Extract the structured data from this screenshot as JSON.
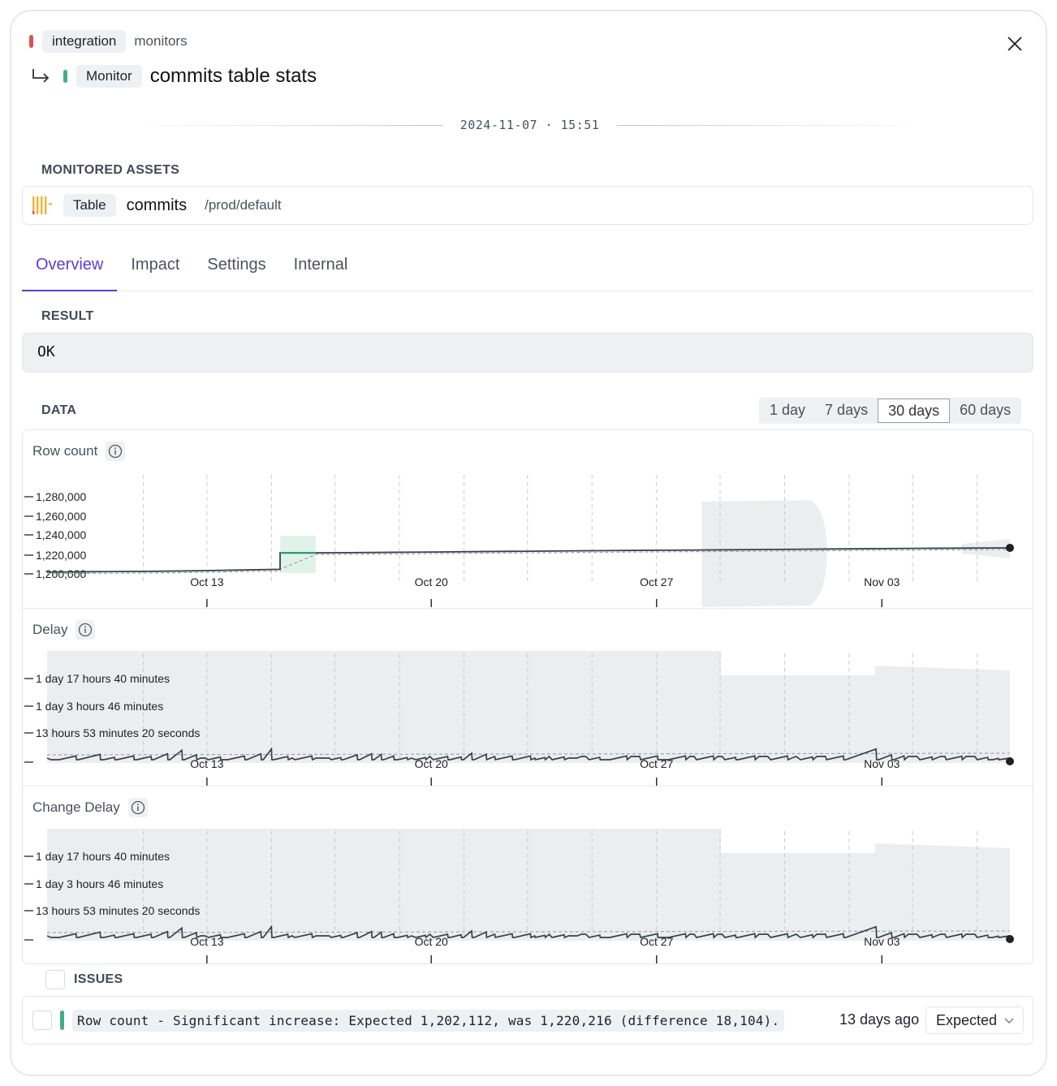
{
  "breadcrumb": {
    "parent_chip": "integration",
    "parent_label": "monitors",
    "type_chip": "Monitor",
    "title": "commits table stats"
  },
  "icons": {
    "return": "return-arrow-icon",
    "close": "close-icon",
    "table": "table-columns-icon",
    "info": "info-icon",
    "chevron": "chevron-down-icon"
  },
  "colors": {
    "accent": "#5b3fd0",
    "status_parent": "#d9534f",
    "status_monitor": "#3fae86",
    "series": "#37414b",
    "anomaly": "#2a9d6e"
  },
  "timestamp": "2024-11-07 · 15:51",
  "assets": {
    "label": "MONITORED ASSETS",
    "chip": "Table",
    "name": "commits",
    "path": "/prod/default"
  },
  "tabs": [
    {
      "label": "Overview",
      "active": true
    },
    {
      "label": "Impact",
      "active": false
    },
    {
      "label": "Settings",
      "active": false
    },
    {
      "label": "Internal",
      "active": false
    }
  ],
  "result": {
    "label": "RESULT",
    "value": "OK"
  },
  "data_section": {
    "label": "DATA"
  },
  "ranges": [
    {
      "label": "1 day",
      "active": false
    },
    {
      "label": "7 days",
      "active": false
    },
    {
      "label": "30 days",
      "active": true
    },
    {
      "label": "60 days",
      "active": false
    }
  ],
  "chart_data": [
    {
      "type": "line",
      "title": "Row count",
      "x_ticks": [
        "Oct 13",
        "Oct 20",
        "Oct 27",
        "Nov 03"
      ],
      "y_ticks": [
        "1,280,000",
        "1,260,000",
        "1,240,000",
        "1,220,000",
        "1,200,000"
      ],
      "ylim": [
        1198000,
        1284000
      ],
      "x": [
        0,
        5,
        10,
        15,
        20,
        24.2,
        24.2,
        27.9,
        30,
        35,
        40,
        45,
        50,
        55,
        60,
        65,
        70,
        75,
        80,
        85,
        90,
        95,
        100
      ],
      "y": [
        1199000,
        1199500,
        1199800,
        1200400,
        1201300,
        1202112,
        1220216,
        1220216,
        1220400,
        1220800,
        1221200,
        1221700,
        1222100,
        1222500,
        1222900,
        1223200,
        1223600,
        1224000,
        1224400,
        1224800,
        1225200,
        1225500,
        1225800
      ],
      "anomaly": {
        "from": 24.2,
        "to": 27.9
      }
    },
    {
      "type": "line",
      "title": "Delay",
      "x_ticks": [
        "Oct 13",
        "Oct 20",
        "Oct 27",
        "Nov 03"
      ],
      "y_ticks": [
        "1 day 17 hours 40 minutes",
        "1 day 3 hours 46 minutes",
        "13 hours 53 minutes 20 seconds",
        ""
      ],
      "peaks": [
        {
          "at": 3,
          "h": 0.35
        },
        {
          "at": 5.5,
          "h": 0.5
        },
        {
          "at": 7,
          "h": 0.22
        },
        {
          "at": 9,
          "h": 0.35
        },
        {
          "at": 10.8,
          "h": 0.3
        },
        {
          "at": 12.5,
          "h": 0.55
        },
        {
          "at": 14,
          "h": 0.88
        },
        {
          "at": 15.5,
          "h": 0.45
        },
        {
          "at": 18,
          "h": 0.25
        },
        {
          "at": 20.5,
          "h": 0.35
        },
        {
          "at": 22.2,
          "h": 0.55
        },
        {
          "at": 23.3,
          "h": 1.0
        },
        {
          "at": 25,
          "h": 0.3
        },
        {
          "at": 27.5,
          "h": 0.35
        },
        {
          "at": 30.5,
          "h": 0.2
        },
        {
          "at": 32.2,
          "h": 0.45
        },
        {
          "at": 33.7,
          "h": 0.55
        },
        {
          "at": 34.7,
          "h": 0.5
        },
        {
          "at": 36,
          "h": 0.35
        },
        {
          "at": 37.4,
          "h": 0.2
        },
        {
          "at": 39.3,
          "h": 0.2
        },
        {
          "at": 41.6,
          "h": 0.3
        },
        {
          "at": 43,
          "h": 0.25
        },
        {
          "at": 44.1,
          "h": 0.6
        },
        {
          "at": 45.6,
          "h": 0.5
        },
        {
          "at": 48.3,
          "h": 0.35
        },
        {
          "at": 50.2,
          "h": 0.35
        },
        {
          "at": 51.7,
          "h": 0.2
        },
        {
          "at": 53.7,
          "h": 0.25
        },
        {
          "at": 57.4,
          "h": 0.22
        },
        {
          "at": 60.2,
          "h": 0.35
        },
        {
          "at": 63.4,
          "h": 0.35
        },
        {
          "at": 66.3,
          "h": 0.35
        },
        {
          "at": 69.2,
          "h": 0.35
        },
        {
          "at": 71.5,
          "h": 0.22
        },
        {
          "at": 73.5,
          "h": 0.35
        },
        {
          "at": 76.9,
          "h": 0.35
        },
        {
          "at": 79.5,
          "h": 0.25
        },
        {
          "at": 82.7,
          "h": 0.35
        },
        {
          "at": 86.1,
          "h": 1.0
        },
        {
          "at": 87.7,
          "h": 0.45
        },
        {
          "at": 89,
          "h": 0.35
        },
        {
          "at": 91.9,
          "h": 0.25
        },
        {
          "at": 95,
          "h": 0.32
        },
        {
          "at": 97.7,
          "h": 0.22
        },
        {
          "at": 98.8,
          "h": 0.12
        }
      ],
      "band_upper": [
        0.91,
        0.91,
        0.91,
        0.91,
        0.91,
        0.91,
        0.91,
        0.91,
        0.91,
        0.91,
        0.91,
        0.91,
        0.91,
        0.91,
        0.91,
        0.91,
        0.91,
        0.91,
        0.91,
        0.91,
        0.91,
        0.91,
        0.91,
        0.91,
        0.91,
        0.91,
        0.91,
        0.91,
        0.91,
        0.91,
        0.91,
        0.91,
        0.91,
        0.91,
        0.91,
        0.91,
        0.91,
        0.91,
        0.91,
        0.91,
        0.91,
        0.91,
        0.91,
        0.91,
        0.91,
        0.91,
        0.91,
        0.91,
        0.91,
        0.91,
        0.91,
        0.91,
        0.91,
        0.91,
        0.91,
        0.91,
        0.91,
        0.91,
        0.91,
        0.91,
        0.91,
        0.91,
        0.91,
        0.91,
        0.91,
        0.91,
        0.91,
        0.91,
        0.91,
        0.91,
        0.91,
        0.91,
        0.91,
        0.91,
        0.91,
        0.91,
        0.91,
        0.91,
        0.91,
        0.91,
        0.91,
        0.91,
        0.91,
        0.91,
        0.91,
        0.91,
        0.91,
        0.91,
        0.91,
        0.91,
        0.91,
        0.91,
        0.91,
        0.91,
        0.91,
        0.91,
        0.91,
        0.91,
        0.91,
        0.91,
        0.91
      ]
    },
    {
      "type": "line",
      "title": "Change Delay",
      "x_ticks": [
        "Oct 13",
        "Oct 20",
        "Oct 27",
        "Nov 03"
      ],
      "y_ticks": [
        "1 day 17 hours 40 minutes",
        "1 day 3 hours 46 minutes",
        "13 hours 53 minutes 20 seconds",
        ""
      ]
    }
  ],
  "issues": {
    "label": "ISSUES",
    "items": [
      {
        "text": "Row count - Significant increase: Expected 1,202,112, was 1,220,216 (difference 18,104).",
        "age": "13 days ago",
        "status": "Expected"
      }
    ]
  }
}
